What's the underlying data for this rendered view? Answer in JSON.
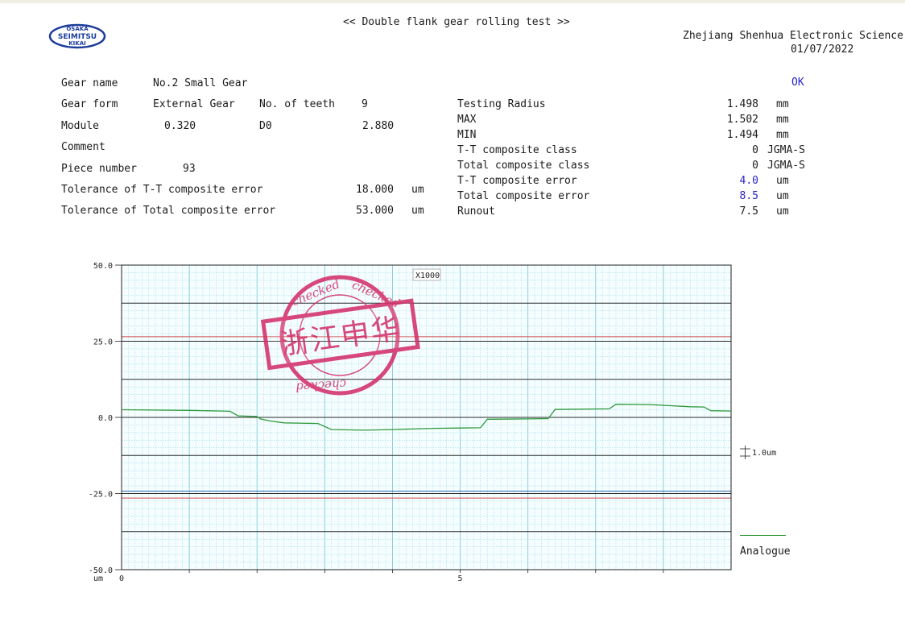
{
  "header": {
    "title": "<< Double flank gear rolling test >>",
    "company": "Zhejiang Shenhua Electronic Science",
    "date": "01/07/2022",
    "logo": {
      "line1": "OSAKA",
      "line2": "SEIMITSU",
      "line3": "KIKAI"
    }
  },
  "info": {
    "gear_name_label": "Gear name",
    "gear_name": "No.2 Small Gear",
    "gear_form_label": "Gear form",
    "gear_form": "External Gear",
    "teeth_label": "No. of teeth",
    "teeth": "9",
    "module_label": "Module",
    "module": "0.320",
    "d0_label": "D0",
    "d0": "2.880",
    "comment_label": "Comment",
    "piece_label": "Piece number",
    "piece": "93",
    "tol_tt_label": "Tolerance of T-T composite error",
    "tol_tt": "18.000",
    "tol_tt_unit": "um",
    "tol_total_label": "Tolerance of Total composite error",
    "tol_total": "53.000",
    "tol_total_unit": "um"
  },
  "results": {
    "status": "OK",
    "rows": [
      {
        "label": "Testing Radius",
        "value": "1.498",
        "unit": "mm",
        "blue": false
      },
      {
        "label": "MAX",
        "value": "1.502",
        "unit": "mm",
        "blue": false
      },
      {
        "label": "MIN",
        "value": "1.494",
        "unit": "mm",
        "blue": false
      },
      {
        "label": "T-T composite class",
        "value": "0",
        "unit": "JGMA-S",
        "blue": false
      },
      {
        "label": "Total composite class",
        "value": "0",
        "unit": "JGMA-S",
        "blue": false
      },
      {
        "label": "T-T composite error",
        "value": "4.0",
        "unit": "um",
        "blue": true
      },
      {
        "label": "Total composite error",
        "value": "8.5",
        "unit": "um",
        "blue": true
      },
      {
        "label": "Runout",
        "value": "7.5",
        "unit": "um",
        "blue": false
      }
    ]
  },
  "stamp": {
    "text": "浙江申华",
    "ring_text": "checked"
  },
  "chart_data": {
    "type": "line",
    "magnification": "X1000",
    "y_tick_labels": [
      "50.0",
      "25.0",
      "0.0",
      "-25.0",
      "-50.0"
    ],
    "y_unit": "um",
    "x_tick_labels": [
      "0",
      "5"
    ],
    "ylim": [
      -50,
      50
    ],
    "xlim": [
      0,
      9
    ],
    "major_lines": [
      37.5,
      25,
      12.5,
      0,
      -12.5,
      -25,
      -37.5
    ],
    "tolerance_lines": [
      26.5,
      -26.5
    ],
    "scale_marker": "1.0um",
    "legend": {
      "label": "Analogue",
      "color": "#2e9a3a",
      "placement": "bottom-right"
    },
    "colors": {
      "grid": "#8fd8e0",
      "major": "#2a2a2a",
      "tolerance": "#d04848",
      "trace": "#2e9a3a",
      "mid": "#2a6aa8"
    },
    "series": [
      {
        "x": [
          0,
          1.0,
          1.6,
          1.72,
          2.0,
          2.05,
          2.2,
          2.4,
          2.9,
          3.0,
          3.1,
          3.6,
          4.0,
          4.6,
          5.0,
          5.3,
          5.4,
          6.0,
          6.3,
          6.4,
          7.2,
          7.3,
          7.8,
          8.4,
          8.6,
          8.7,
          9.0
        ],
        "y": [
          2.5,
          2.3,
          2.0,
          0.5,
          0.3,
          -0.5,
          -1.2,
          -1.8,
          -2.0,
          -3.0,
          -4.0,
          -4.2,
          -4.0,
          -3.6,
          -3.5,
          -3.4,
          -0.6,
          -0.5,
          -0.4,
          2.6,
          2.8,
          4.3,
          4.2,
          3.5,
          3.4,
          2.2,
          2.1
        ]
      }
    ]
  }
}
